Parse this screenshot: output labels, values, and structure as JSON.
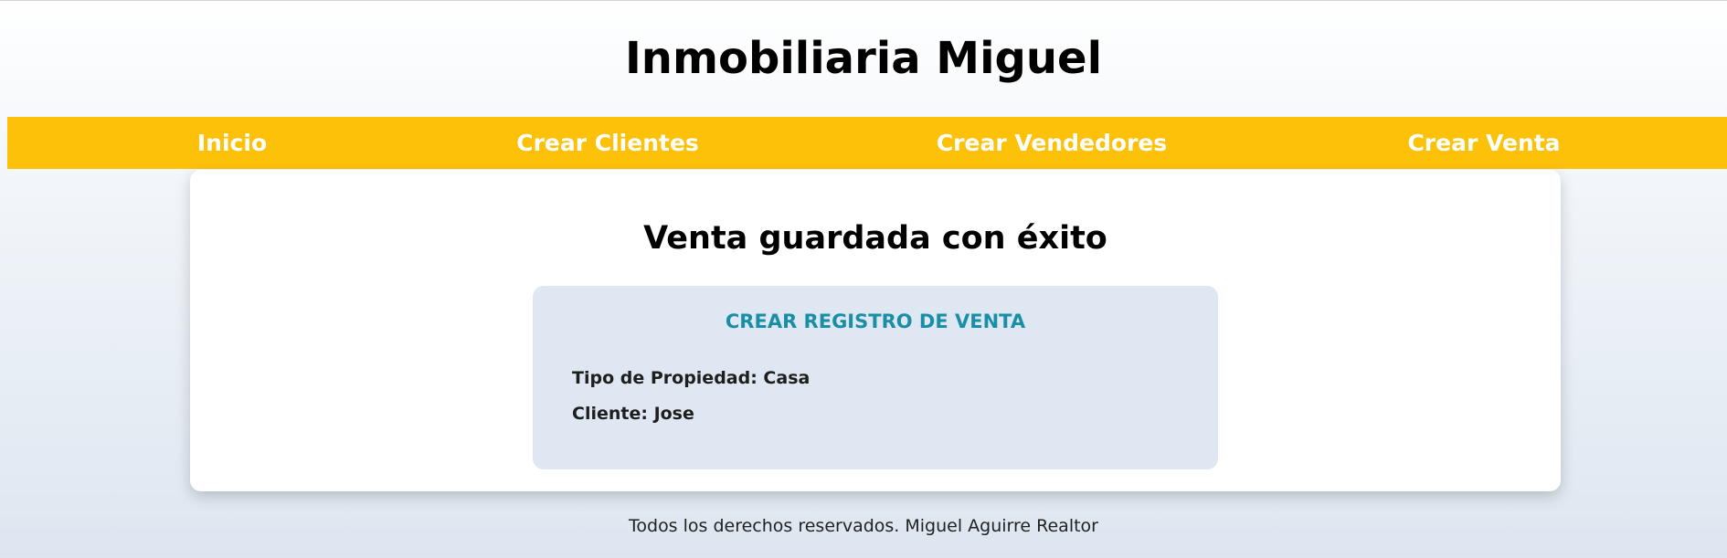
{
  "header": {
    "site_title": "Inmobiliaria Miguel"
  },
  "nav": {
    "items": [
      {
        "label": "Inicio"
      },
      {
        "label": "Crear Clientes"
      },
      {
        "label": "Crear Vendedores"
      },
      {
        "label": "Crear Venta"
      }
    ],
    "background_color": "#fdc10a"
  },
  "main": {
    "title": "Venta guardada con éxito",
    "record": {
      "heading": "CREAR REGISTRO DE VENTA",
      "property_type_line": "Tipo de Propiedad: Casa",
      "client_line": "Cliente: Jose"
    }
  },
  "footer": {
    "text": "Todos los derechos reservados. Miguel Aguirre Realtor"
  }
}
